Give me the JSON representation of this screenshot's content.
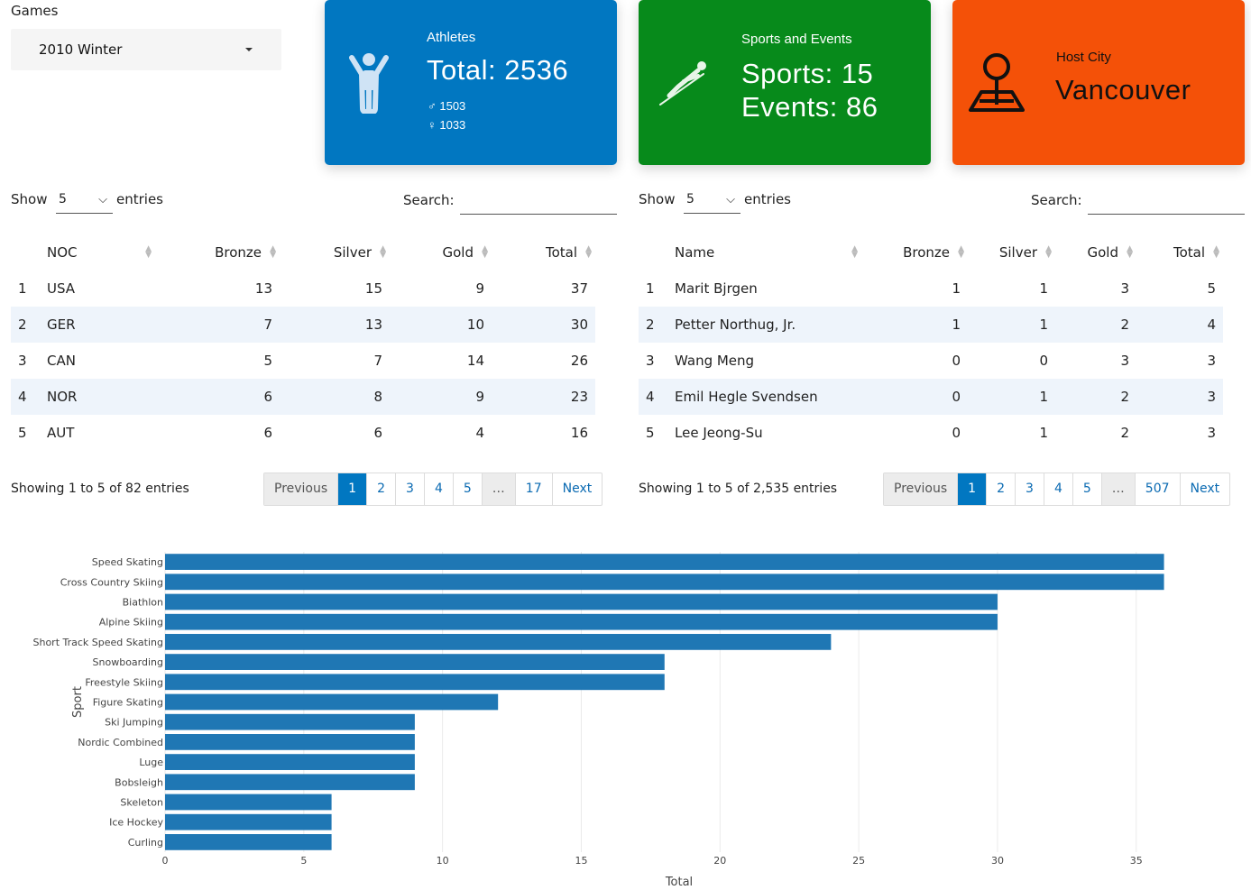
{
  "games": {
    "label": "Games",
    "selected": "2010 Winter"
  },
  "value_boxes": {
    "athletes": {
      "title": "Athletes",
      "total": "Total: 2536",
      "male": "♂ 1503",
      "female": "♀ 1033",
      "icon": "person-raising-arms-icon",
      "color": "#0177c1"
    },
    "sports": {
      "title": "Sports and Events",
      "sports": "Sports: 15",
      "events": "Events: 86",
      "icon": "ski-jumping-icon",
      "color": "#078a1b"
    },
    "host": {
      "title": "Host City",
      "city": "Vancouver",
      "icon": "map-pin-icon",
      "color": "#f45108"
    }
  },
  "noc_table": {
    "show_label": "Show",
    "entries_label": "entries",
    "page_length": "5",
    "search_label": "Search:",
    "search_value": "",
    "columns": [
      "",
      "NOC",
      "Bronze",
      "Silver",
      "Gold",
      "Total"
    ],
    "rows": [
      [
        "1",
        "USA",
        "13",
        "15",
        "9",
        "37"
      ],
      [
        "2",
        "GER",
        "7",
        "13",
        "10",
        "30"
      ],
      [
        "3",
        "CAN",
        "5",
        "7",
        "14",
        "26"
      ],
      [
        "4",
        "NOR",
        "6",
        "8",
        "9",
        "23"
      ],
      [
        "5",
        "AUT",
        "6",
        "6",
        "4",
        "16"
      ]
    ],
    "info": "Showing 1 to 5 of 82 entries",
    "pager": [
      "Previous",
      "1",
      "2",
      "3",
      "4",
      "5",
      "…",
      "17",
      "Next"
    ],
    "active_page": "1"
  },
  "athlete_table": {
    "show_label": "Show",
    "entries_label": "entries",
    "page_length": "5",
    "search_label": "Search:",
    "search_value": "",
    "columns": [
      "",
      "Name",
      "Bronze",
      "Silver",
      "Gold",
      "Total"
    ],
    "rows": [
      [
        "1",
        "Marit Bjrgen",
        "1",
        "1",
        "3",
        "5"
      ],
      [
        "2",
        "Petter Northug, Jr.",
        "1",
        "1",
        "2",
        "4"
      ],
      [
        "3",
        "Wang Meng",
        "0",
        "0",
        "3",
        "3"
      ],
      [
        "4",
        "Emil Hegle Svendsen",
        "0",
        "1",
        "2",
        "3"
      ],
      [
        "5",
        "Lee Jeong-Su",
        "0",
        "1",
        "2",
        "3"
      ]
    ],
    "info": "Showing 1 to 5 of 2,535 entries",
    "pager": [
      "Previous",
      "1",
      "2",
      "3",
      "4",
      "5",
      "…",
      "507",
      "Next"
    ],
    "active_page": "1"
  },
  "chart_data": {
    "type": "bar",
    "orientation": "horizontal",
    "categories": [
      "Speed Skating",
      "Cross Country Skiing",
      "Biathlon",
      "Alpine Skiing",
      "Short Track Speed Skating",
      "Snowboarding",
      "Freestyle Skiing",
      "Figure Skating",
      "Ski Jumping",
      "Nordic Combined",
      "Luge",
      "Bobsleigh",
      "Skeleton",
      "Ice Hockey",
      "Curling"
    ],
    "values": [
      36,
      36,
      30,
      30,
      24,
      18,
      18,
      12,
      9,
      9,
      9,
      9,
      6,
      6,
      6
    ],
    "xlabel": "Total",
    "ylabel": "Sport",
    "xlim": [
      0,
      37.9
    ],
    "xticks": [
      0,
      5,
      10,
      15,
      20,
      25,
      30,
      35
    ],
    "grid": true,
    "bar_color": "#1f77b4"
  }
}
